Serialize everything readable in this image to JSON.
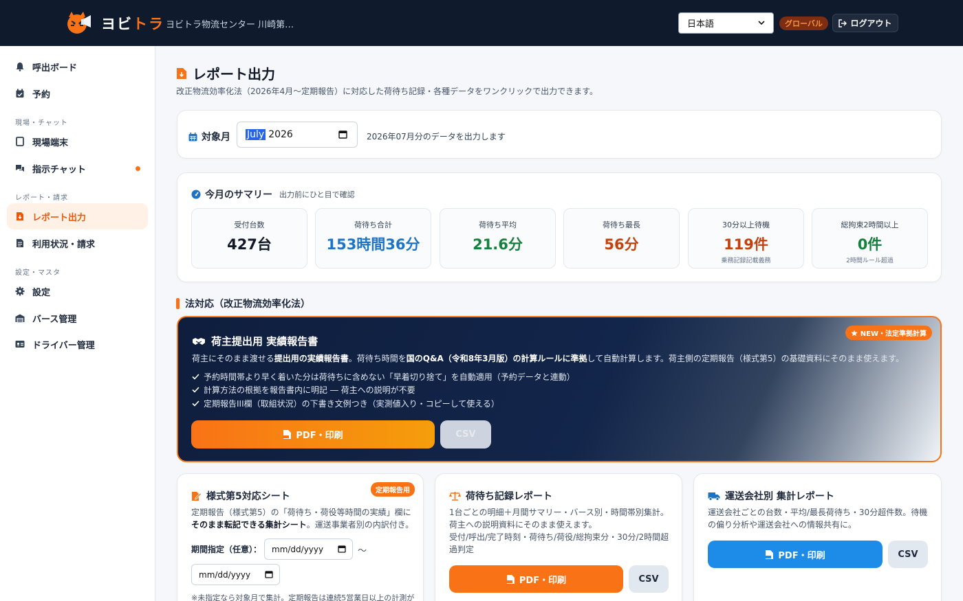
{
  "header": {
    "brand_1": "ヨビ",
    "brand_2": "トラ",
    "center_name": "ヨビトラ物流センター 川崎第…",
    "language": "日本語",
    "global_label": "グローバル",
    "logout_label": "ログアウト"
  },
  "sidebar": {
    "items": [
      {
        "label": "呼出ボード",
        "icon": "bell-icon"
      },
      {
        "label": "予約",
        "icon": "calendar-check-icon"
      },
      {
        "label": "現場端末",
        "icon": "tablet-icon"
      },
      {
        "label": "指示チャット",
        "icon": "chat-icon"
      },
      {
        "label": "レポート出力",
        "icon": "file-download-icon",
        "active": true
      },
      {
        "label": "利用状況・請求",
        "icon": "invoice-icon"
      },
      {
        "label": "設定",
        "icon": "gear-icon"
      },
      {
        "label": "バース管理",
        "icon": "warehouse-icon"
      },
      {
        "label": "ドライバー管理",
        "icon": "id-card-icon"
      }
    ],
    "sections": [
      "現場・チャット",
      "レポート・請求",
      "設定・マスタ"
    ]
  },
  "page": {
    "title": "レポート出力",
    "subtitle": "改正物流効率化法（2026年4月〜定期報告）に対応した荷待ち記録・各種データをワンクリックで出力できます。"
  },
  "month": {
    "label": "対象月",
    "month_text": "July",
    "year_text": "2026",
    "note": "2026年07月分のデータを出力します"
  },
  "summary": {
    "title": "今月のサマリー",
    "subtitle": "出力前にひと目で確認",
    "stats": [
      {
        "label": "受付台数",
        "value": "427台",
        "note": "",
        "color": "#111827"
      },
      {
        "label": "荷待ち合計",
        "value": "153時間36分",
        "note": "",
        "color": "#1d74c4"
      },
      {
        "label": "荷待ち平均",
        "value": "21.6分",
        "note": "",
        "color": "#15803d"
      },
      {
        "label": "荷待ち最長",
        "value": "56分",
        "note": "",
        "color": "#c2410c"
      },
      {
        "label": "30分以上待機",
        "value": "119件",
        "note": "乗務記録記載義務",
        "color": "#c2410c"
      },
      {
        "label": "総拘束2時間以上",
        "value": "0件",
        "note": "2時間ルール超過",
        "color": "#15803d"
      }
    ]
  },
  "legal_section": {
    "title": "法対応（改正物流効率化法）"
  },
  "hero": {
    "badge": "NEW・法定準拠計算",
    "title": "荷主提出用 実績報告書",
    "desc_1": "荷主にそのまま渡せる",
    "desc_2": "提出用の実績報告書",
    "desc_3": "。荷待ち時間を",
    "desc_4": "国のQ&A（令和8年3月版）の計算ルールに準拠",
    "desc_5": "して自動計算します。荷主側の定期報告（様式第5）の基礎資料にそのまま使えます。",
    "checks": [
      "予約時間帯より早く着いた分は荷待ちに含めない「早着切り捨て」を自動適用（予約データと連動）",
      "計算方法の根拠を報告書内に明記 ― 荷主への説明が不要",
      "定期報告III欄（取組状況）の下書き文例つき（実測値入り・コピーして使える）"
    ],
    "pdf_label": "PDF・印刷",
    "csv_label": "CSV"
  },
  "cards": {
    "form5": {
      "title": "様式第5対応シート",
      "tag": "定期報告用",
      "desc_1": "定期報告（様式第5）の「荷待ち・荷役等時間の実績」欄に",
      "desc_2": "そのまま転記できる集計シート",
      "desc_3": "。運送事業者別の内訳付き。",
      "period_label": "期間指定（任意）：",
      "date_placeholder": "mm/dd/yyyy",
      "tilde": "〜",
      "footnote": "※未指定なら対象月で集計。定期報告は連続5営業日以上の計測が"
    },
    "waiting": {
      "title": "荷待ち記録レポート",
      "desc_1": "1台ごとの明細＋月間サマリー・バース別・時間帯別集計。",
      "desc_2": "荷主への説明資料にそのまま使えます。",
      "desc_3": "受付/呼出/完了時刻・荷待ち/荷役/総拘束分・30分/2時間超",
      "desc_4": "過判定",
      "pdf_label": "PDF・印刷",
      "csv_label": "CSV"
    },
    "carrier": {
      "title": "運送会社別 集計レポート",
      "desc_1": "運送会社ごとの台数・平均/最長荷待ち・30分超件数。待機",
      "desc_2": "の偏り分析や運送会社への情報共有に。",
      "pdf_label": "PDF・印刷",
      "csv_label": "CSV"
    }
  }
}
